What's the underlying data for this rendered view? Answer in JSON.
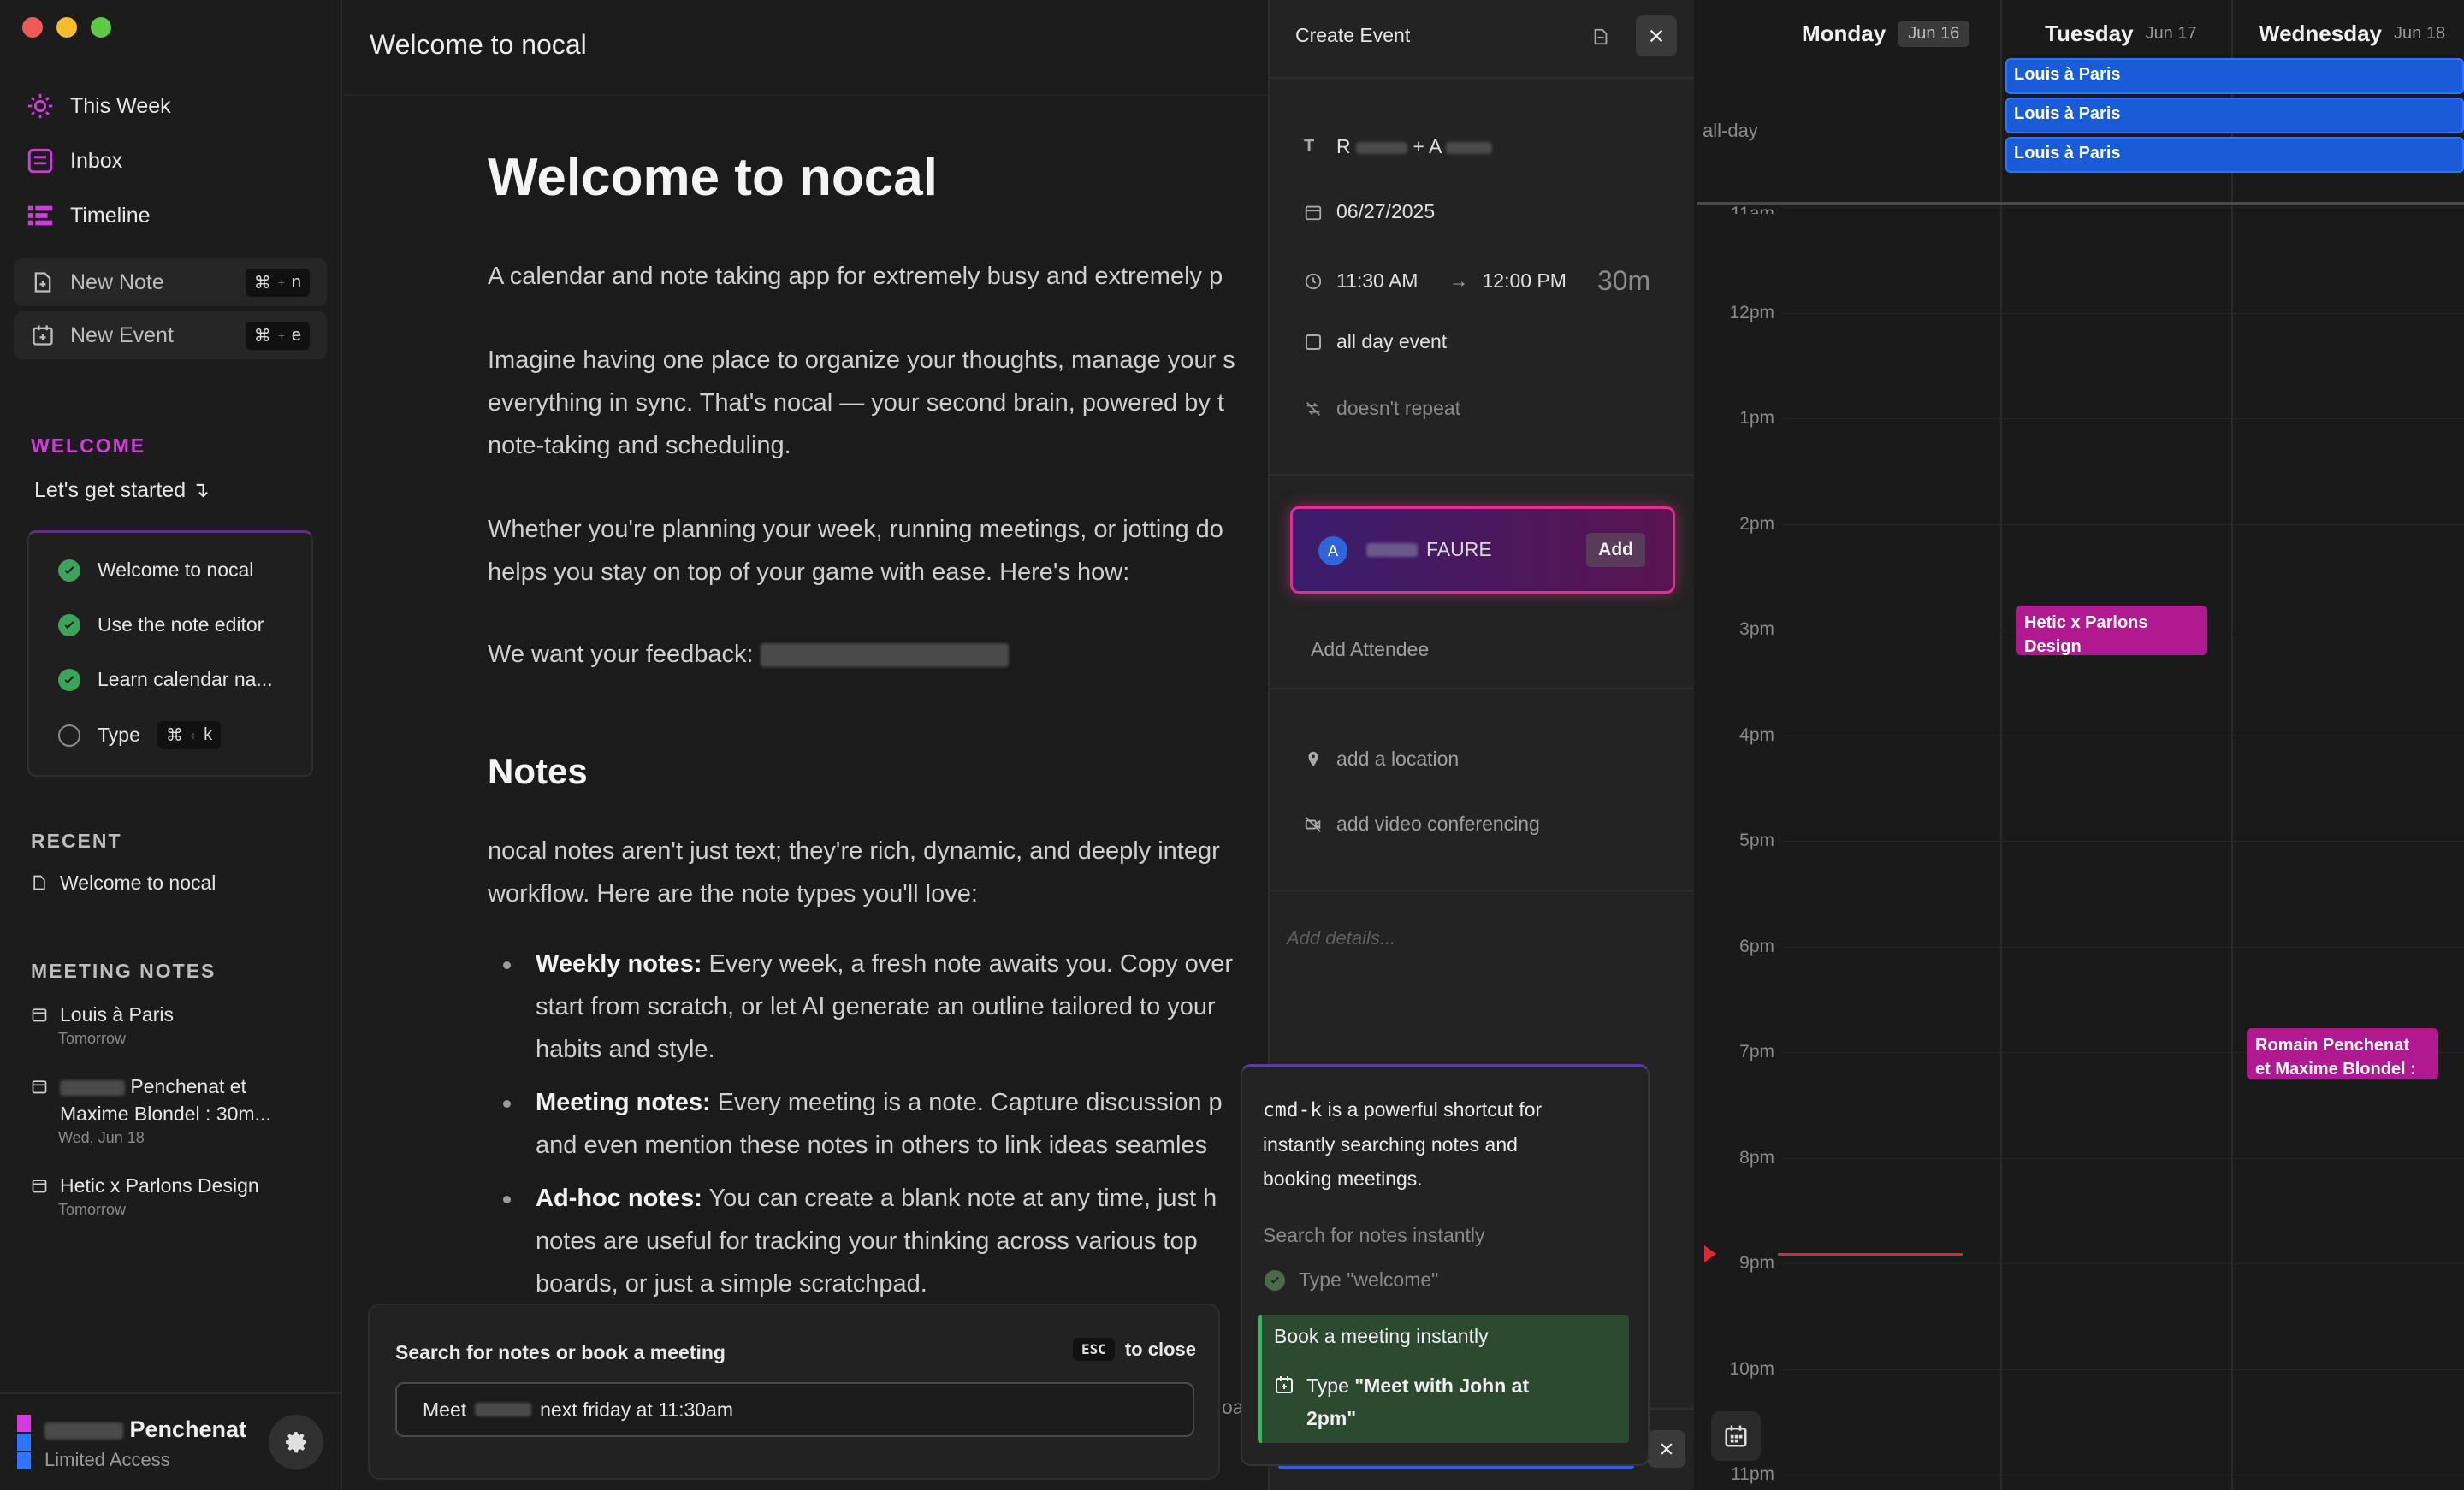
{
  "sidebar": {
    "nav": [
      {
        "label": "This Week",
        "icon": "sun-icon"
      },
      {
        "label": "Inbox",
        "icon": "inbox-icon"
      },
      {
        "label": "Timeline",
        "icon": "timeline-icon"
      }
    ],
    "new_note": {
      "label": "New Note",
      "shortcut_mod": "⌘",
      "shortcut_key": "n"
    },
    "new_event": {
      "label": "New Event",
      "shortcut_mod": "⌘",
      "shortcut_key": "e"
    },
    "welcome_label": "WELCOME",
    "get_started": "Let's get started ↴",
    "checklist": [
      {
        "label": "Welcome to nocal",
        "done": true
      },
      {
        "label": "Use the note editor",
        "done": true
      },
      {
        "label": "Learn calendar na...",
        "done": true
      },
      {
        "label": "Type",
        "done": false,
        "kbd_mod": "⌘",
        "kbd_key": "k"
      }
    ],
    "recent_label": "RECENT",
    "recent": [
      {
        "label": "Welcome to nocal"
      }
    ],
    "meeting_notes_label": "MEETING NOTES",
    "meeting_notes": [
      {
        "line1": "Louis à Paris",
        "line2": "",
        "sub": "Tomorrow"
      },
      {
        "line1": "Penchenat et",
        "line2": "Maxime Blondel : 30m...",
        "sub": "Wed, Jun 18"
      },
      {
        "line1": "Hetic x Parlons Design",
        "line2": "",
        "sub": "Tomorrow"
      }
    ],
    "user": {
      "name": "Penchenat",
      "plan": "Limited Access"
    }
  },
  "main": {
    "title": "Welcome to nocal",
    "h1": "Welcome to nocal",
    "p1": "A calendar and note taking app for extremely busy and extremely p",
    "p2_l1": "Imagine having one place to organize your thoughts, manage your s",
    "p2_l2": "everything in sync. That's nocal — your second brain, powered by t",
    "p2_l3": "note-taking and scheduling.",
    "p3_l1": "Whether you're planning your week, running meetings, or jotting do",
    "p3_l2": "helps you stay on top of your game with ease. Here's how:",
    "feedback": "We want your feedback:",
    "h2": "Notes",
    "p4_l1": "nocal notes aren't just text; they're rich, dynamic, and deeply integr",
    "p4_l2": "workflow. Here are the note types you'll love:",
    "bullets": [
      {
        "title": "Weekly notes:",
        "l1": " Every week, a fresh note awaits you. Copy over",
        "l2": "start from scratch, or let AI generate an outline tailored to your",
        "l3": "habits and style."
      },
      {
        "title": "Meeting notes:",
        "l1": " Every meeting is a note. Capture discussion p",
        "l2": "and even mention these notes in others to link ideas seamles",
        "l3": ""
      },
      {
        "title": "Ad-hoc notes:",
        "l1": " You can create a blank note at any time, just h",
        "l2": "notes are useful for tracking your thinking across various top",
        "l3": "boards, or just a simple scratchpad."
      }
    ],
    "search": {
      "title": "Search for notes or book a meeting",
      "esc": "ESC",
      "to_close": "to close",
      "value_prefix": "Meet",
      "value_suffix": "next friday at 11:30am",
      "trailing": "oa"
    }
  },
  "event": {
    "title": "Create Event",
    "name": "R + A",
    "date": "06/27/2025",
    "start": "11:30 AM",
    "end": "12:00 PM",
    "duration": "30m",
    "allday": "all day event",
    "repeat": "doesn't repeat",
    "attendee_initial": "A",
    "attendee_name": "FAURE",
    "attendee_add": "Add",
    "add_attendee": "Add Attendee",
    "location": "add a location",
    "video": "add video conferencing",
    "details_placeholder": "Add details..."
  },
  "tooltip": {
    "code": "cmd-k",
    "l1": " is a powerful shortcut for",
    "l2": "instantly searching notes and",
    "l3": "booking meetings.",
    "section": "Search for notes instantly",
    "done_item": "Type \"welcome\"",
    "active_title": "Book a meeting instantly",
    "active_prefix": "Type ",
    "active_strong_l1": "\"Meet with John at",
    "active_strong_l2": "2pm\""
  },
  "calendar": {
    "days": [
      {
        "name": "Monday",
        "date": "Jun 16"
      },
      {
        "name": "Tuesday",
        "date": "Jun 17"
      },
      {
        "name": "Wednesday",
        "date": "Jun 18"
      }
    ],
    "allday_label": "all-day",
    "allday_events": [
      "Louis à Paris",
      "Louis à Paris",
      "Louis à Paris"
    ],
    "hours": [
      "11am",
      "12pm",
      "1pm",
      "2pm",
      "3pm",
      "4pm",
      "5pm",
      "6pm",
      "7pm",
      "8pm",
      "9pm",
      "10pm",
      "11pm"
    ],
    "events": [
      {
        "title_l1": "Hetic x Parlons",
        "title_l2": "Design"
      },
      {
        "title_l1": "Romain Penchenat",
        "title_l2": "et Maxime Blondel :"
      }
    ],
    "colors": {
      "allday": "#1a5bd8",
      "event": "#b0198f",
      "now_line": "#e0262e"
    }
  }
}
